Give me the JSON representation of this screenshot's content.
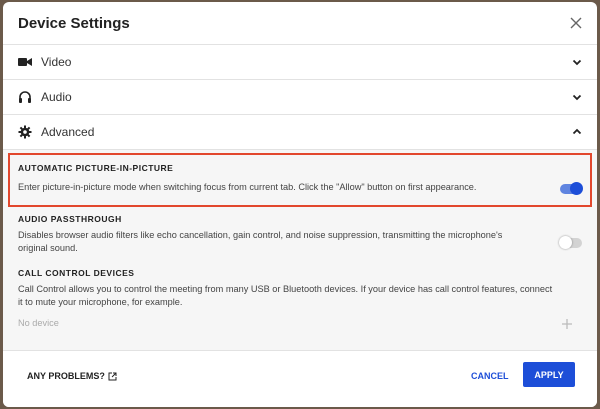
{
  "dialog": {
    "title": "Device Settings",
    "close_icon": "close-icon"
  },
  "sections": [
    {
      "label": "Video",
      "icon": "video-camera-icon",
      "state": "collapsed"
    },
    {
      "label": "Audio",
      "icon": "headphones-icon",
      "state": "collapsed"
    },
    {
      "label": "Advanced",
      "icon": "gear-icon",
      "state": "expanded"
    }
  ],
  "advanced": {
    "pip": {
      "title": "AUTOMATIC PICTURE-IN-PICTURE",
      "desc": "Enter picture-in-picture mode when switching focus from current tab. Click the \"Allow\" button on first appearance.",
      "enabled": true
    },
    "passthrough": {
      "title": "AUDIO PASSTHROUGH",
      "desc": "Disables browser audio filters like echo cancellation, gain control, and noise suppression, transmitting the microphone's original sound.",
      "enabled": false
    },
    "call_control": {
      "title": "CALL CONTROL DEVICES",
      "desc": "Call Control allows you to control the meeting from many USB or Bluetooth devices. If your device has call control features, connect it to mute your microphone, for example.",
      "device_placeholder": "No device"
    }
  },
  "footer": {
    "problems_label": "ANY PROBLEMS?",
    "cancel_label": "CANCEL",
    "apply_label": "APPLY"
  },
  "colors": {
    "accent": "#1d4ed8",
    "highlight": "#e2472d"
  }
}
